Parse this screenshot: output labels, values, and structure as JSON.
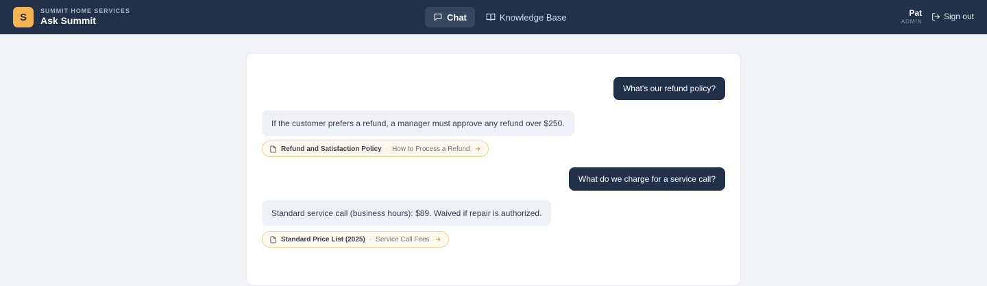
{
  "header": {
    "logo_letter": "S",
    "company": "SUMMIT HOME SERVICES",
    "app_title": "Ask Summit",
    "tabs": [
      {
        "label": "Chat",
        "icon": "chat-bubble-icon",
        "active": true
      },
      {
        "label": "Knowledge Base",
        "icon": "book-icon",
        "active": false
      }
    ],
    "user": {
      "name": "Pat",
      "role": "ADMIN"
    },
    "signout_label": "Sign out"
  },
  "conversation": [
    {
      "role": "user",
      "text": "What's our refund policy?"
    },
    {
      "role": "assistant",
      "text": "If the customer prefers a refund, a manager must approve any refund over $250.",
      "source": {
        "title": "Refund and Satisfaction Policy",
        "separator": "·",
        "section": "How to Process a Refund"
      }
    },
    {
      "role": "user",
      "text": "What do we charge for a service call?"
    },
    {
      "role": "assistant",
      "text": "Standard service call (business hours): $89. Waived if repair is authorized.",
      "source": {
        "title": "Standard Price List (2025)",
        "separator": "·",
        "section": "Service Call Fees"
      }
    }
  ],
  "colors": {
    "navbar": "#22304a",
    "accent": "#f6b352",
    "background": "#eff3f6",
    "user_bubble": "#22304a",
    "assistant_bubble": "#eef1f5",
    "source_border": "#f5cf94"
  }
}
